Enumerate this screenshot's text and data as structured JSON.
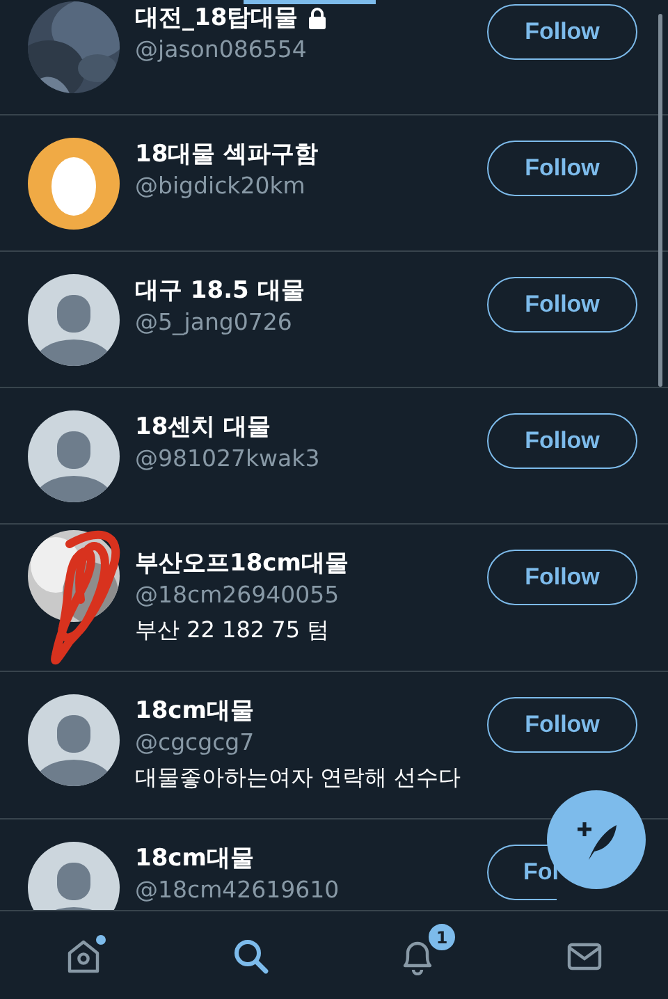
{
  "users": [
    {
      "name": "대전_18탑대물",
      "protected": true,
      "handle": "@jason086554",
      "follow_label": "Follow"
    },
    {
      "avatar": {
        "kind": "egg"
      },
      "name": "18대물 섹파구함",
      "protected": false,
      "handle": "@bigdick20km",
      "follow_label": "Follow"
    },
    {
      "avatar": {
        "kind": "default"
      },
      "name": "대구 18.5 대물",
      "protected": false,
      "handle": "@5_jang0726",
      "follow_label": "Follow"
    },
    {
      "avatar": {
        "kind": "default"
      },
      "name": "18센치 대물",
      "protected": false,
      "handle": "@981027kwak3",
      "follow_label": "Follow"
    },
    {
      "avatar": {
        "kind": "scribbled"
      },
      "name": "부산오프18cm대물",
      "protected": false,
      "handle": "@18cm26940055",
      "bio": "부산 22 182 75 텀",
      "follow_label": "Follow"
    },
    {
      "avatar": {
        "kind": "default"
      },
      "name": "18cm대물",
      "protected": false,
      "handle": "@cgcgcg7",
      "bio": "대물좋아하는여자 연락해 선수다",
      "follow_label": "Follow"
    },
    {
      "avatar": {
        "kind": "default"
      },
      "name": "18cm대물",
      "protected": false,
      "handle": "@18cm42619610",
      "follow_label": "Fol"
    }
  ],
  "tab_bar": [
    {
      "kind": "home",
      "selected": false,
      "dot": true
    },
    {
      "kind": "search",
      "selected": true,
      "dot": false
    },
    {
      "kind": "notifications",
      "selected": false,
      "dot": false,
      "badge": "1"
    },
    {
      "kind": "messages",
      "selected": false,
      "dot": false
    }
  ]
}
